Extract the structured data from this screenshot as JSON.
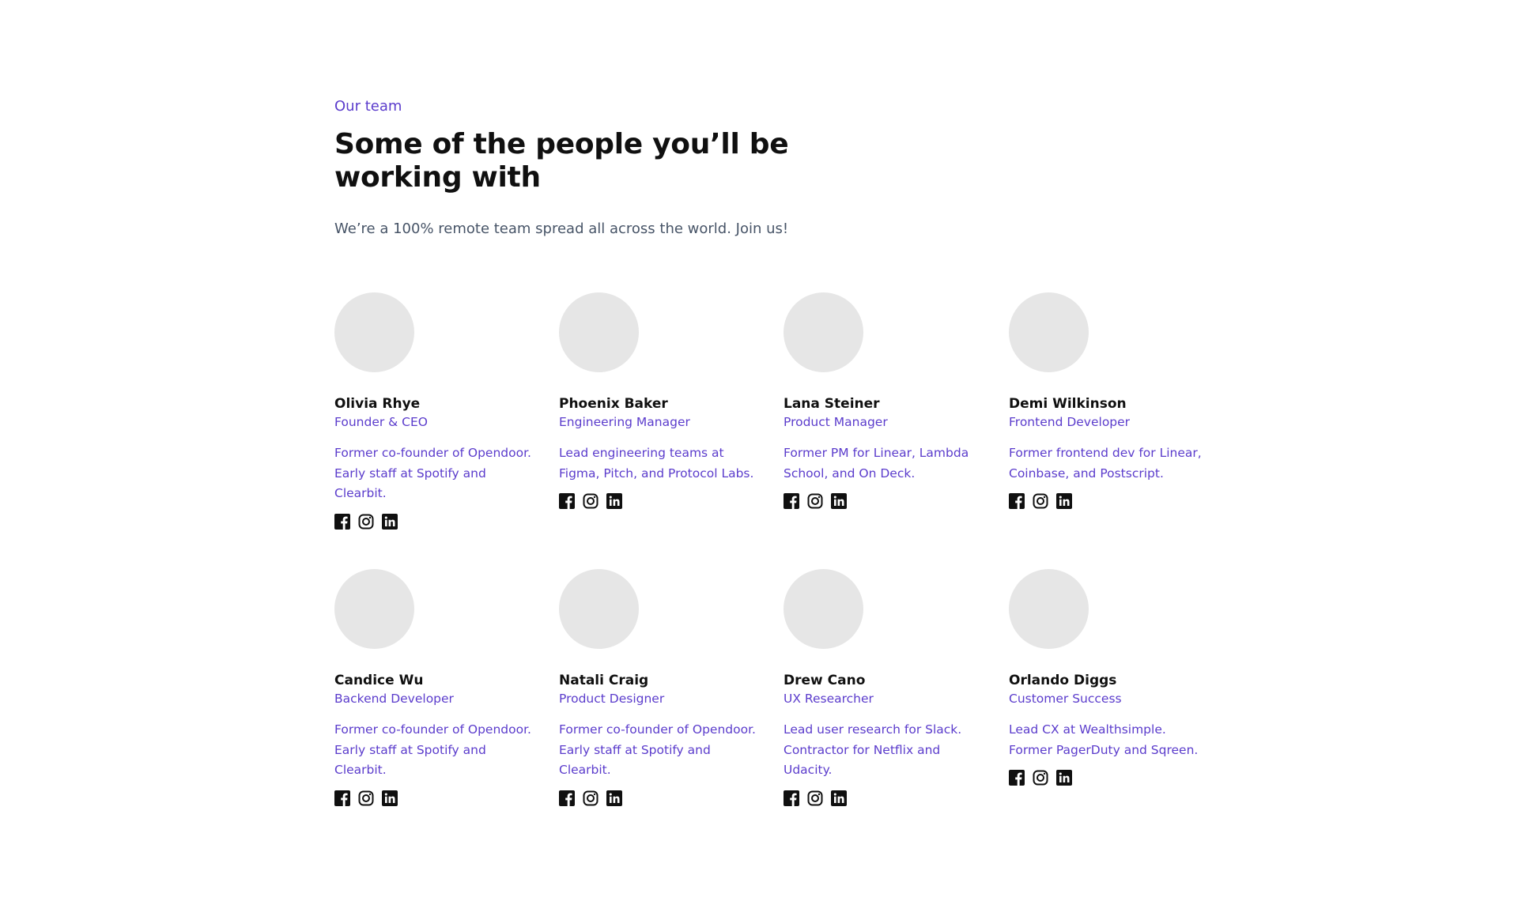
{
  "section": {
    "eyebrow": "Our team",
    "heading": "Some of the people you’ll be working with",
    "subheading": "We’re a 100% remote team spread all across the world. Join us!"
  },
  "colors": {
    "accent": "#5b3ccc",
    "avatar_placeholder": "#e6e6e6",
    "icon": "#101010"
  },
  "social_icons": [
    "facebook-icon",
    "instagram-icon",
    "linkedin-icon"
  ],
  "team": [
    {
      "name": "Olivia Rhye",
      "role": "Founder & CEO",
      "bio": "Former co-founder of Opendoor. Early staff at Spotify and Clearbit."
    },
    {
      "name": "Phoenix Baker",
      "role": "Engineering Manager",
      "bio": "Lead engineering teams at Figma, Pitch, and Protocol Labs."
    },
    {
      "name": "Lana Steiner",
      "role": "Product Manager",
      "bio": "Former PM for Linear, Lambda School, and On Deck."
    },
    {
      "name": "Demi Wilkinson",
      "role": "Frontend Developer",
      "bio": "Former frontend dev for Linear, Coinbase, and Postscript."
    },
    {
      "name": "Candice Wu",
      "role": "Backend Developer",
      "bio": "Former co-founder of Opendoor. Early staff at Spotify and Clearbit."
    },
    {
      "name": "Natali Craig",
      "role": "Product Designer",
      "bio": "Former co-founder of Opendoor. Early staff at Spotify and Clearbit."
    },
    {
      "name": "Drew Cano",
      "role": "UX Researcher",
      "bio": "Lead user research for Slack. Contractor for Netflix and Udacity."
    },
    {
      "name": "Orlando Diggs",
      "role": "Customer Success",
      "bio": "Lead CX at Wealthsimple. Former PagerDuty and Sqreen."
    }
  ]
}
